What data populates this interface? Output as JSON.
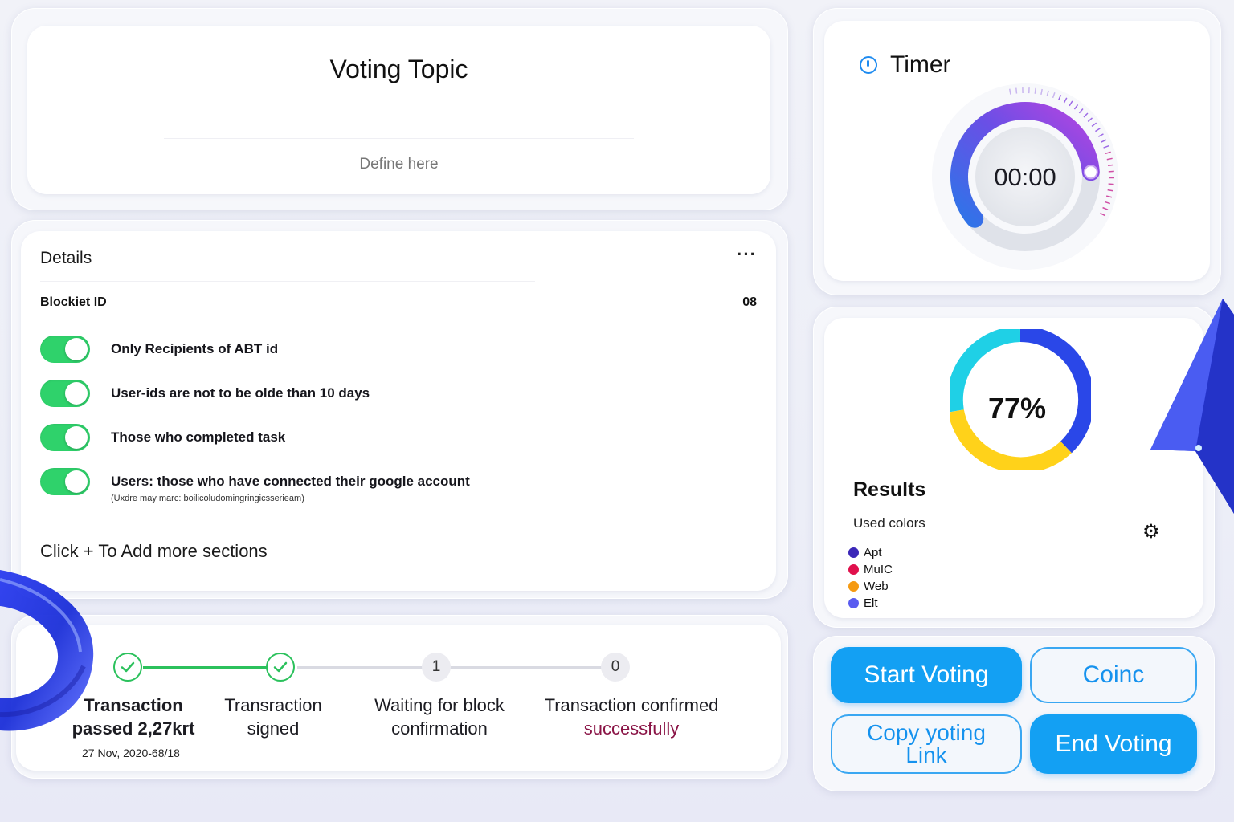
{
  "topic": {
    "title": "Voting Topic",
    "placeholder": "Define here"
  },
  "details": {
    "title": "Details",
    "more": "···",
    "block_id_label": "Blockiet ID",
    "block_id_value": "08",
    "rules": [
      {
        "label": "Only Recipients of ABT id",
        "enabled": true
      },
      {
        "label": "User-ids are not to be olde than 10 days",
        "enabled": true
      },
      {
        "label": "Those who completed task",
        "enabled": true
      },
      {
        "label": "Users: those who have connected their google account",
        "enabled": true
      }
    ],
    "rule_note": "(Uxdre may marc: boilicoludomingringicsserieam)",
    "add_more": "Click + To Add more sections"
  },
  "steps": {
    "items": [
      {
        "line1": "Transaction",
        "line2": "passed 2,27krt",
        "status": "done"
      },
      {
        "line1": "Transraction",
        "line2": "signed",
        "status": "done"
      },
      {
        "line1": "Waiting for block",
        "line2": "confirmation",
        "status": "pending",
        "count": "1"
      },
      {
        "line1": "Transaction confirmed",
        "line2": "successfully",
        "status": "pending",
        "count": "0"
      }
    ],
    "date": "27 Nov, 2020-68/18"
  },
  "timer": {
    "label": "Timer",
    "value": "00:00",
    "progress": 0.72
  },
  "results": {
    "percent": "77%",
    "title": "Results",
    "used_colors_label": "Used colors",
    "legend": [
      {
        "name": "Apt",
        "color": "#3b27b8"
      },
      {
        "name": "MuIC",
        "color": "#e0104c"
      },
      {
        "name": "Web",
        "color": "#f59a12"
      },
      {
        "name": "Elt",
        "color": "#5a5cf0"
      }
    ],
    "ring_colors": {
      "cyan": "#1fd0e6",
      "blue": "#2a47e8",
      "yellow": "#ffd21a"
    }
  },
  "actions": {
    "start": "Start Voting",
    "coinc": "Coinc",
    "copy": "Copy yoting Link",
    "end": "End Voting"
  }
}
